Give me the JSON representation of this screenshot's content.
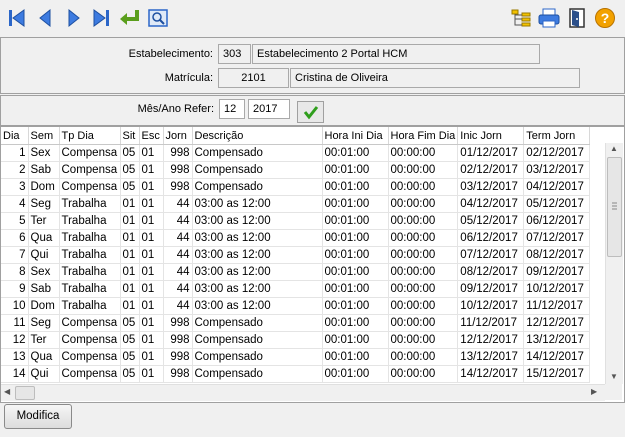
{
  "toolbar": {
    "buttons": [
      "first-icon",
      "previous-icon",
      "next-icon",
      "last-icon",
      "enter-icon",
      "preview-icon"
    ],
    "right_buttons": [
      "hierarchy-icon",
      "print-icon",
      "exit-icon",
      "help-icon"
    ],
    "colors": {
      "nav_blue": "#2b66c8",
      "enter_green": "#5a9e1c",
      "help_orange": "#f2a100"
    }
  },
  "header": {
    "estabelecimento_label": "Estabelecimento:",
    "estabelecimento_code": "303",
    "estabelecimento_name": "Estabelecimento 2 Portal HCM",
    "matricula_label": "Matrícula:",
    "matricula_code": "2101",
    "matricula_name": "Cristina de Oliveira"
  },
  "filter": {
    "label": "Mês/Ano Refer:",
    "month": "12",
    "year": "2017"
  },
  "grid": {
    "columns": [
      "Dia",
      "Sem",
      "Tp Dia",
      "Sit",
      "Esc",
      "Jorn",
      "Descrição",
      "Hora Ini Dia",
      "Hora Fim Dia",
      "Inic  Jorn",
      "Term  Jorn"
    ],
    "rows": [
      [
        "1",
        "Sex",
        "Compensa",
        "05",
        "01",
        "998",
        "Compensado",
        "00:01:00",
        "00:00:00",
        "01/12/2017",
        "02/12/2017"
      ],
      [
        "2",
        "Sab",
        "Compensa",
        "05",
        "01",
        "998",
        "Compensado",
        "00:01:00",
        "00:00:00",
        "02/12/2017",
        "03/12/2017"
      ],
      [
        "3",
        "Dom",
        "Compensa",
        "05",
        "01",
        "998",
        "Compensado",
        "00:01:00",
        "00:00:00",
        "03/12/2017",
        "04/12/2017"
      ],
      [
        "4",
        "Seg",
        "Trabalha",
        "01",
        "01",
        "44",
        "03:00 as 12:00",
        "00:01:00",
        "00:00:00",
        "04/12/2017",
        "05/12/2017"
      ],
      [
        "5",
        "Ter",
        "Trabalha",
        "01",
        "01",
        "44",
        "03:00 as 12:00",
        "00:01:00",
        "00:00:00",
        "05/12/2017",
        "06/12/2017"
      ],
      [
        "6",
        "Qua",
        "Trabalha",
        "01",
        "01",
        "44",
        "03:00 as 12:00",
        "00:01:00",
        "00:00:00",
        "06/12/2017",
        "07/12/2017"
      ],
      [
        "7",
        "Qui",
        "Trabalha",
        "01",
        "01",
        "44",
        "03:00 as 12:00",
        "00:01:00",
        "00:00:00",
        "07/12/2017",
        "08/12/2017"
      ],
      [
        "8",
        "Sex",
        "Trabalha",
        "01",
        "01",
        "44",
        "03:00 as 12:00",
        "00:01:00",
        "00:00:00",
        "08/12/2017",
        "09/12/2017"
      ],
      [
        "9",
        "Sab",
        "Trabalha",
        "01",
        "01",
        "44",
        "03:00 as 12:00",
        "00:01:00",
        "00:00:00",
        "09/12/2017",
        "10/12/2017"
      ],
      [
        "10",
        "Dom",
        "Trabalha",
        "01",
        "01",
        "44",
        "03:00 as 12:00",
        "00:01:00",
        "00:00:00",
        "10/12/2017",
        "11/12/2017"
      ],
      [
        "11",
        "Seg",
        "Compensa",
        "05",
        "01",
        "998",
        "Compensado",
        "00:01:00",
        "00:00:00",
        "11/12/2017",
        "12/12/2017"
      ],
      [
        "12",
        "Ter",
        "Compensa",
        "05",
        "01",
        "998",
        "Compensado",
        "00:01:00",
        "00:00:00",
        "12/12/2017",
        "13/12/2017"
      ],
      [
        "13",
        "Qua",
        "Compensa",
        "05",
        "01",
        "998",
        "Compensado",
        "00:01:00",
        "00:00:00",
        "13/12/2017",
        "14/12/2017"
      ],
      [
        "14",
        "Qui",
        "Compensa",
        "05",
        "01",
        "998",
        "Compensado",
        "00:01:00",
        "00:00:00",
        "14/12/2017",
        "15/12/2017"
      ]
    ]
  },
  "footer": {
    "modify_label": "Modifica"
  }
}
